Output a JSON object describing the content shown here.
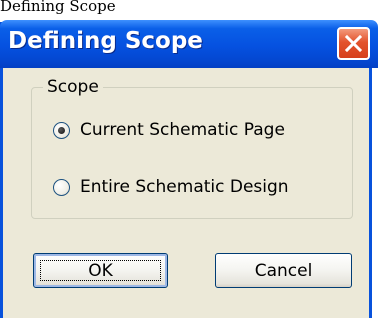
{
  "page_caption": "Defining Scope",
  "dialog": {
    "title": "Defining Scope",
    "close_icon": "close-icon"
  },
  "scope_group": {
    "legend": "Scope",
    "options": [
      {
        "label": "Current Schematic Page",
        "selected": true
      },
      {
        "label": "Entire Schematic Design",
        "selected": false
      }
    ]
  },
  "buttons": {
    "ok_label": "OK",
    "cancel_label": "Cancel"
  },
  "colors": {
    "titlebar": "#0551e0",
    "dialog_bg": "#ece9d8",
    "close_button": "#e3532c"
  }
}
